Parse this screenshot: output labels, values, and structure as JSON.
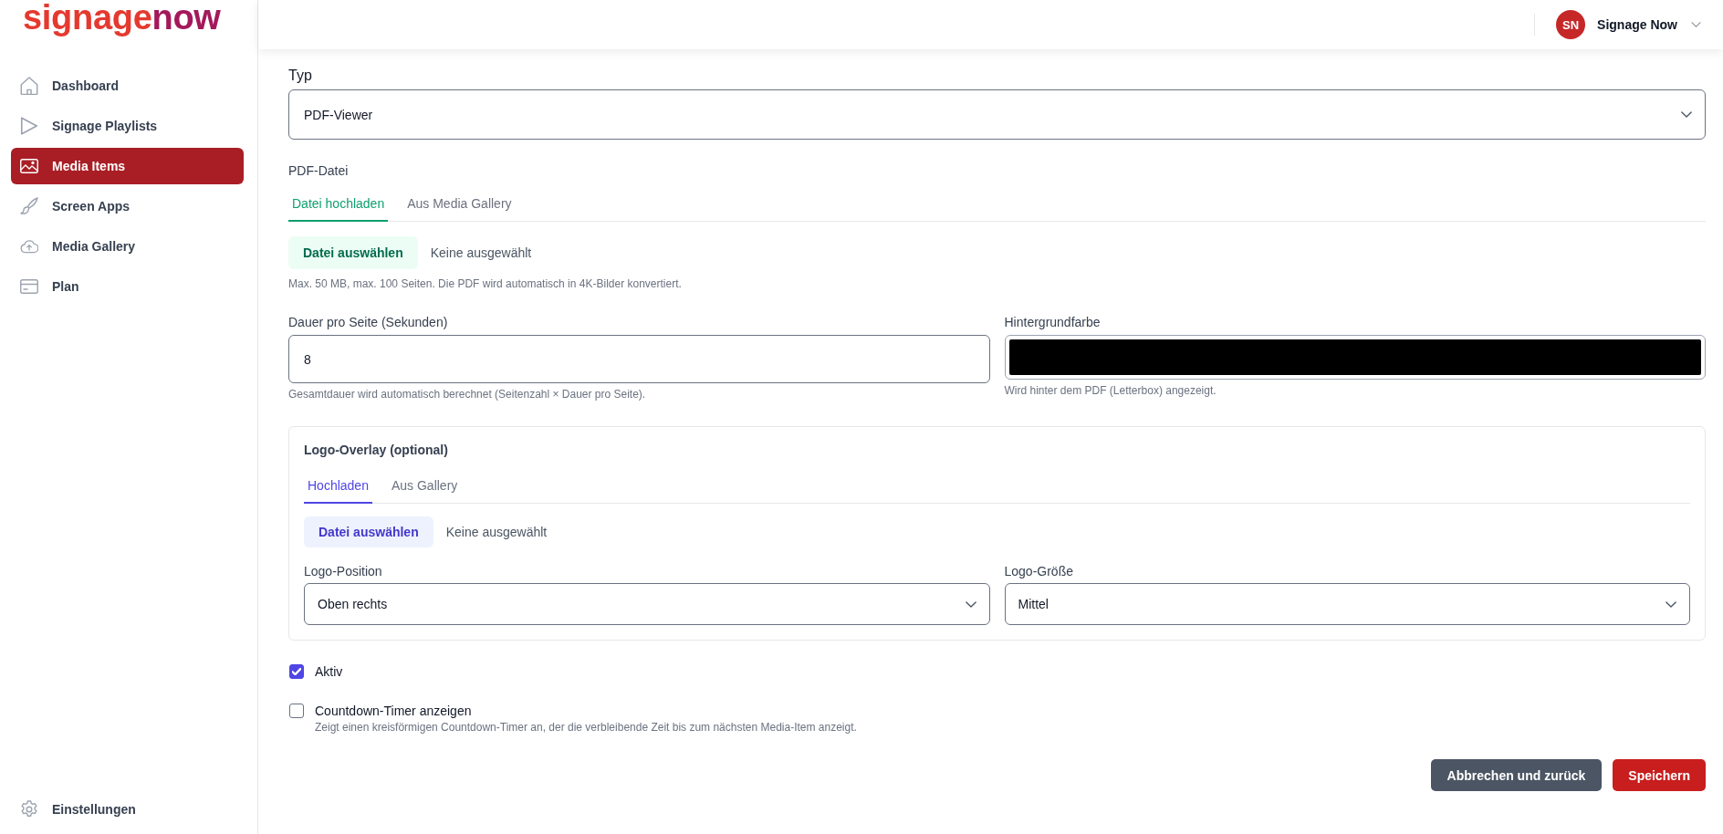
{
  "sidebar": {
    "logo": {
      "first_part": "signage",
      "second_part": "now"
    },
    "items": [
      {
        "label": "Dashboard",
        "selected": false
      },
      {
        "label": "Signage Playlists",
        "selected": false
      },
      {
        "label": "Media Items",
        "selected": true
      },
      {
        "label": "Screen Apps",
        "selected": false
      },
      {
        "label": "Media Gallery",
        "selected": false
      },
      {
        "label": "Plan",
        "selected": false
      }
    ],
    "settings_item": {
      "label": "Einstellungen"
    }
  },
  "header": {
    "user": {
      "initials": "SN",
      "name": "Signage Now"
    }
  },
  "form": {
    "type_field": {
      "label": "Typ",
      "value": "PDF-Viewer"
    },
    "pdf_file": {
      "label": "PDF-Datei",
      "tabs": [
        {
          "label": "Datei hochladen",
          "selected": true
        },
        {
          "label": "Aus Media Gallery",
          "selected": false
        }
      ],
      "file_button": "Datei auswählen",
      "file_status": "Keine ausgewählt",
      "hint": "Max. 50 MB, max. 100 Seiten. Die PDF wird automatisch in 4K-Bilder konvertiert."
    },
    "duration": {
      "label": "Dauer pro Seite (Sekunden)",
      "value": "8",
      "hint": "Gesamtdauer wird automatisch berechnet (Seitenzahl × Dauer pro Seite)."
    },
    "background_color": {
      "label": "Hintergrundfarbe",
      "color": "#000000",
      "hint": "Wird hinter dem PDF (Letterbox) angezeigt."
    },
    "logo_overlay": {
      "title": "Logo-Overlay (optional)",
      "tabs": [
        {
          "label": "Hochladen",
          "selected": true
        },
        {
          "label": "Aus Gallery",
          "selected": false
        }
      ],
      "file_button": "Datei auswählen",
      "file_status": "Keine ausgewählt",
      "position": {
        "label": "Logo-Position",
        "value": "Oben rechts"
      },
      "size": {
        "label": "Logo-Größe",
        "value": "Mittel"
      }
    },
    "checkboxes": [
      {
        "label": "Aktiv",
        "checked": true
      },
      {
        "label": "Countdown-Timer anzeigen",
        "checked": false,
        "hint": "Zeigt einen kreisförmigen Countdown-Timer an, der die verbleibende Zeit bis zum nächsten Media-Item anzeigt."
      }
    ],
    "buttons": [
      {
        "label": "Abbrechen und zurück",
        "kind": "secondary"
      },
      {
        "label": "Speichern",
        "kind": "primary"
      }
    ]
  }
}
